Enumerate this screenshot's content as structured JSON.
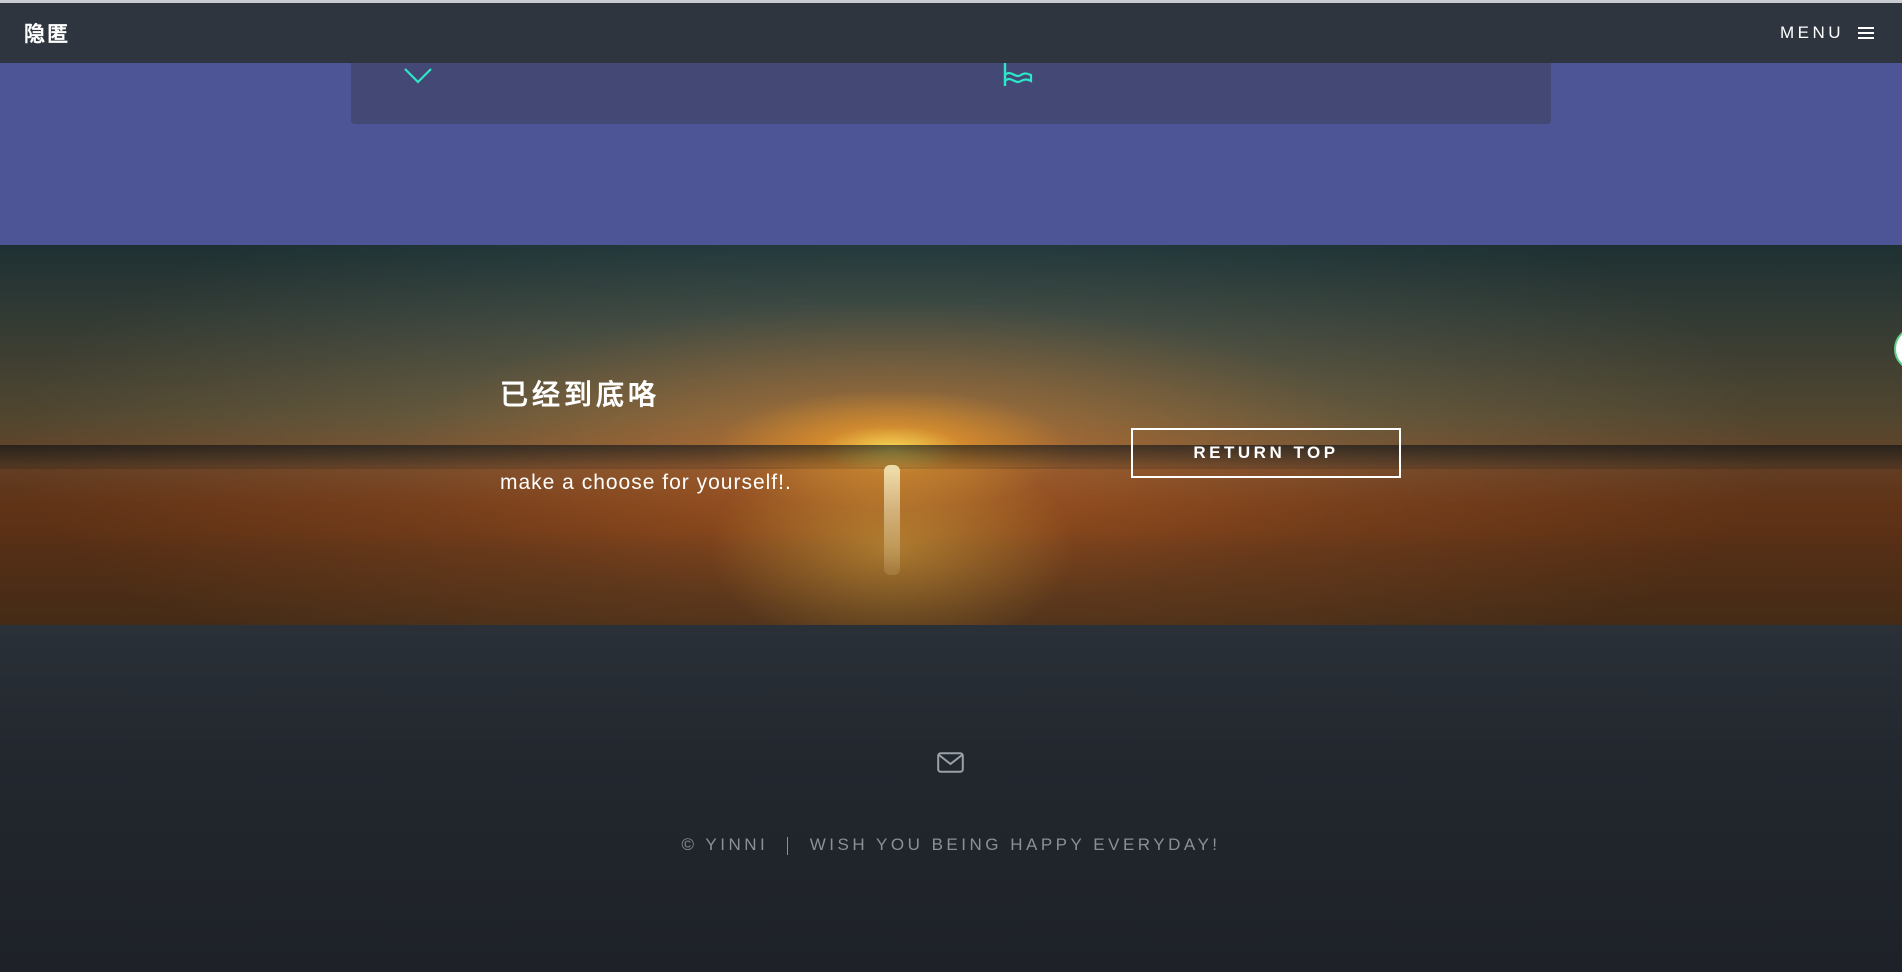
{
  "header": {
    "brand": "隐匿",
    "menu_label": "MENU"
  },
  "features": {
    "icons": [
      "chevron-down-icon",
      "flag-icon"
    ],
    "accent_color": "#2ee6c8"
  },
  "cta": {
    "title": "已经到底咯",
    "subtitle": "make a choose for yourself!.",
    "button_label": "RETURN TOP"
  },
  "footer": {
    "icon": "mail-icon",
    "copyright": "© YINNI",
    "tagline": "WISH YOU BEING HAPPY EVERYDAY!"
  },
  "colors": {
    "topbar": "#2e353e",
    "feature_band": "#4e5597",
    "feature_box": "#434875",
    "footer": "#22272e"
  }
}
